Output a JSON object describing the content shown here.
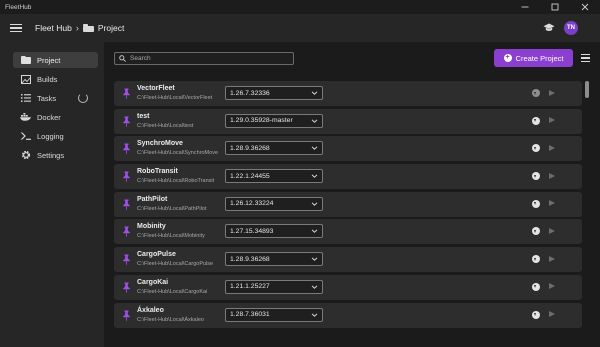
{
  "window": {
    "title": "FleetHub",
    "controls": [
      "minimize",
      "maximize",
      "close"
    ]
  },
  "appbar": {
    "breadcrumb": [
      {
        "label": "Fleet Hub"
      },
      {
        "label": "Project"
      }
    ],
    "user_initials": "TN"
  },
  "sidebar": {
    "items": [
      {
        "label": "Project",
        "icon": "folder-icon",
        "active": true
      },
      {
        "label": "Builds",
        "icon": "image-icon"
      },
      {
        "label": "Tasks",
        "icon": "tasks-icon",
        "loading": true
      },
      {
        "label": "Docker",
        "icon": "docker-icon"
      },
      {
        "label": "Logging",
        "icon": "terminal-icon"
      },
      {
        "label": "Settings",
        "icon": "gear-icon"
      }
    ]
  },
  "toolbar": {
    "search_placeholder": "Search",
    "create_label": "Create Project"
  },
  "colors": {
    "accent": "#8a3fd1",
    "pin": "#a24ee8",
    "row_bg": "#2d2d2d"
  },
  "projects": [
    {
      "name": "VectorFleet",
      "path": "C:\\Fleet-Hub\\Local\\VectorFleet",
      "version": "1.26.7.32336",
      "downloaded": false
    },
    {
      "name": "test",
      "path": "C:\\Fleet-Hub\\Local\\test",
      "version": "1.29.0.35928-master",
      "downloaded": true
    },
    {
      "name": "SynchroMove",
      "path": "C:\\Fleet-Hub\\Local\\SynchroMove",
      "version": "1.28.9.36268",
      "downloaded": true
    },
    {
      "name": "RoboTransit",
      "path": "C:\\Fleet-Hub\\Local\\RoboTransit",
      "version": "1.22.1.24455",
      "downloaded": true
    },
    {
      "name": "PathPilot",
      "path": "C:\\Fleet-Hub\\Local\\PathPilot",
      "version": "1.26.12.33224",
      "downloaded": true
    },
    {
      "name": "Mobinity",
      "path": "C:\\Fleet-Hub\\Local\\Mobinity",
      "version": "1.27.15.34893",
      "downloaded": true
    },
    {
      "name": "CargoPulse",
      "path": "C:\\Fleet-Hub\\Local\\CargoPulse",
      "version": "1.28.9.36268",
      "downloaded": true
    },
    {
      "name": "CargoKai",
      "path": "C:\\Fleet-Hub\\Local\\CargoKai",
      "version": "1.21.1.25227",
      "downloaded": true
    },
    {
      "name": "Áxkaleo",
      "path": "C:\\Fleet-Hub\\Local\\Áxkaleo",
      "version": "1.28.7.36031",
      "downloaded": true
    }
  ]
}
